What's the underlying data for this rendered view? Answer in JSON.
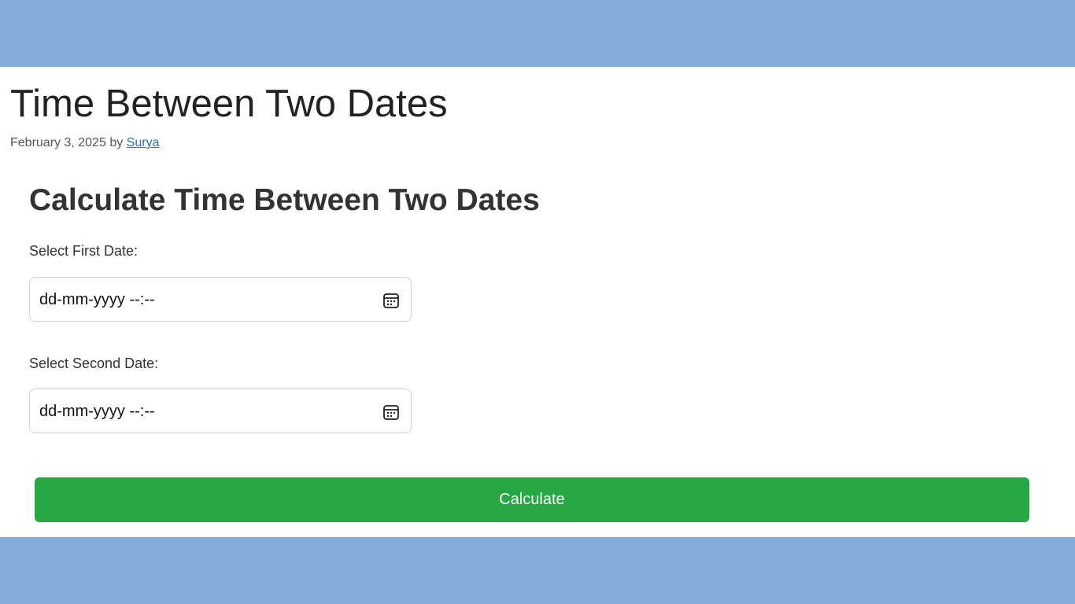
{
  "post": {
    "title": "Time Between Two Dates",
    "date": "February 3, 2025",
    "by": "by",
    "author": "Surya"
  },
  "calculator": {
    "heading": "Calculate Time Between Two Dates",
    "first_label": "Select First Date:",
    "first_value": "dd-mm-yyyy --:--",
    "second_label": "Select Second Date:",
    "second_value": "dd-mm-yyyy --:--",
    "button_label": "Calculate",
    "icon": "calendar-icon"
  },
  "colors": {
    "band": "#84acdb",
    "button": "#28a745",
    "link": "#1e73be"
  }
}
